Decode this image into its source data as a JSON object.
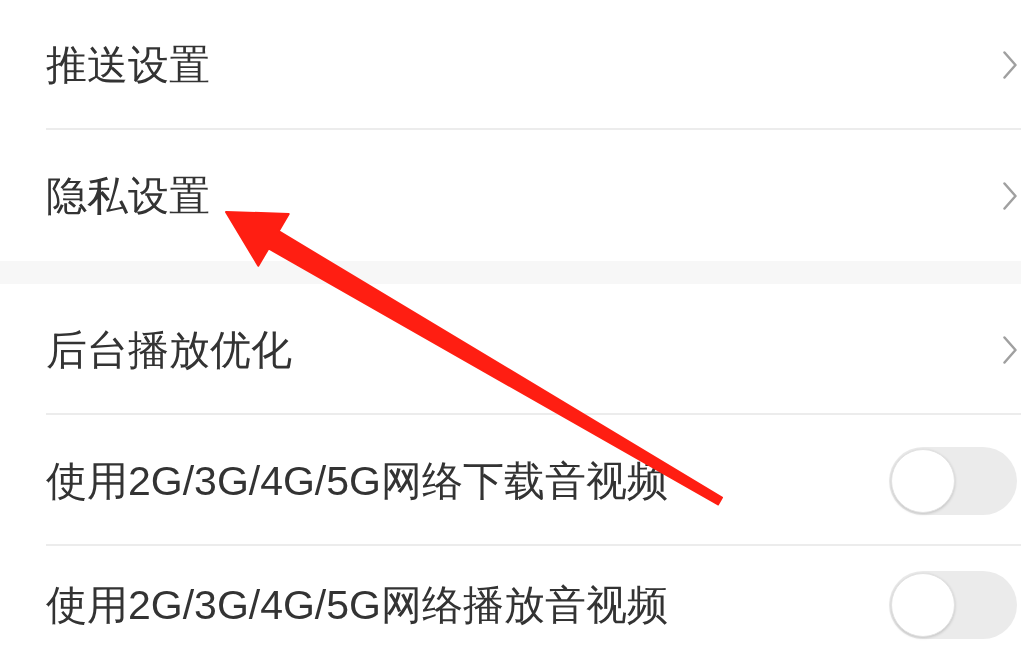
{
  "sections": [
    {
      "items": [
        {
          "kind": "link",
          "label": "推送设置"
        },
        {
          "kind": "link",
          "label": "隐私设置"
        }
      ]
    },
    {
      "items": [
        {
          "kind": "link",
          "label": "后台播放优化"
        },
        {
          "kind": "switch",
          "label": "使用2G/3G/4G/5G网络下载音视频",
          "on": false
        },
        {
          "kind": "switch",
          "label": "使用2G/3G/4G/5G网络播放音视频",
          "on": false
        }
      ]
    }
  ]
}
